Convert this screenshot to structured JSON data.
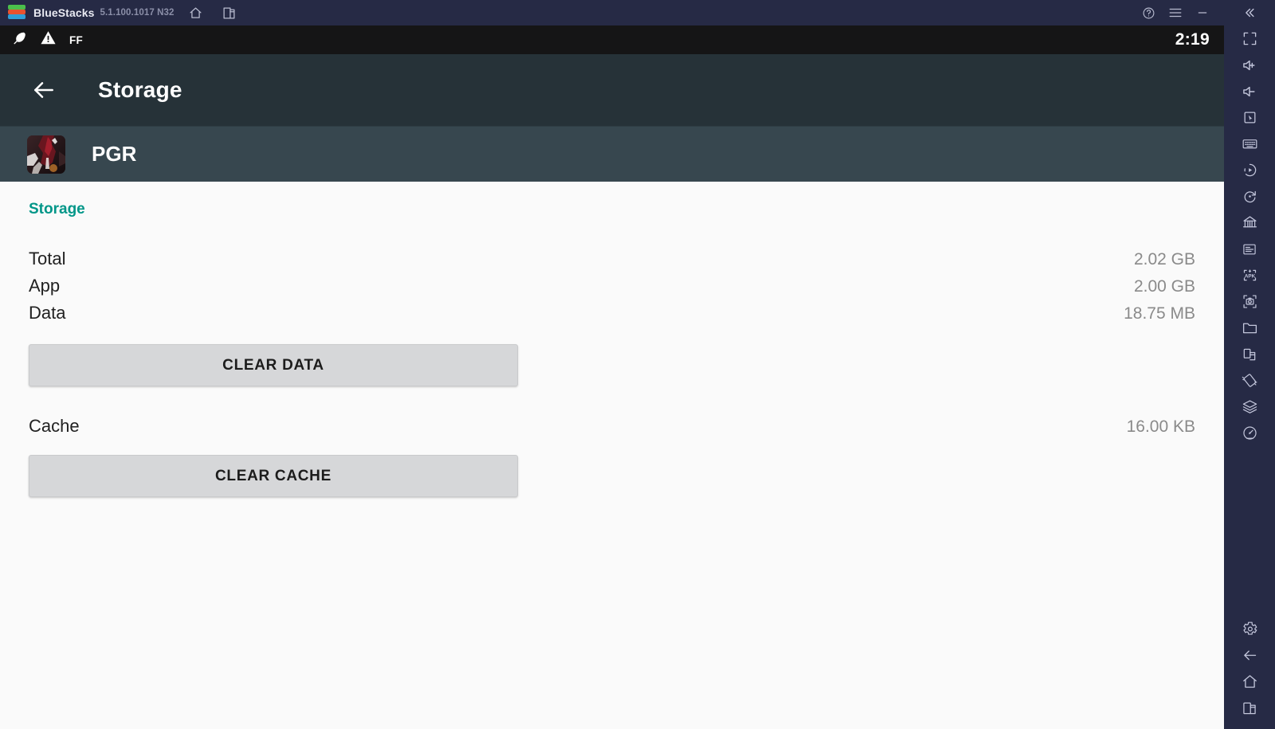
{
  "window": {
    "brand": "BlueStacks",
    "version": "5.1.100.1017 N32",
    "icons": {
      "logo": "bluestacks-logo",
      "home": "home-icon",
      "instances": "multi-instance-icon",
      "help": "help-circle-icon",
      "menu": "hamburger-menu-icon",
      "minimize": "minimize-icon",
      "maximize": "maximize-icon",
      "close": "close-icon"
    }
  },
  "android_status_bar": {
    "icons": [
      "feather-icon",
      "warning-triangle-icon"
    ],
    "badge_text": "FF",
    "clock": "2:19"
  },
  "appbar": {
    "back_label": "back-arrow",
    "title": "Storage"
  },
  "app_header": {
    "app_name": "PGR",
    "icon_name": "pgr-app-icon"
  },
  "content": {
    "section_title": "Storage",
    "rows": [
      {
        "label": "Total",
        "value": "2.02 GB"
      },
      {
        "label": "App",
        "value": "2.00 GB"
      },
      {
        "label": "Data",
        "value": "18.75 MB"
      }
    ],
    "clear_data_button": "CLEAR DATA",
    "cache": {
      "label": "Cache",
      "value": "16.00 KB"
    },
    "clear_cache_button": "CLEAR CACHE"
  },
  "sidebar": {
    "collapse": "collapse-chevrons-icon",
    "items": [
      "fullscreen-icon",
      "volume-up-icon",
      "volume-down-icon",
      "cursor-pointer-icon",
      "keyboard-icon",
      "macro-record-icon",
      "rotate-icon",
      "game-controls-icon",
      "script-icon",
      "install-apk-icon",
      "screenshot-icon",
      "media-folder-icon",
      "multi-instance-icon",
      "shake-icon",
      "layers-icon",
      "performance-icon",
      "settings-gear-icon",
      "back-icon",
      "home-icon",
      "recents-icon"
    ]
  },
  "colors": {
    "window_chrome": "#262a45",
    "status_bar": "#151516",
    "appbar": "#263238",
    "app_header": "#37474f",
    "content_bg": "#fafafa",
    "accent_teal": "#009688",
    "button_bg": "#d6d7d9",
    "value_text": "#8a8a8a"
  }
}
